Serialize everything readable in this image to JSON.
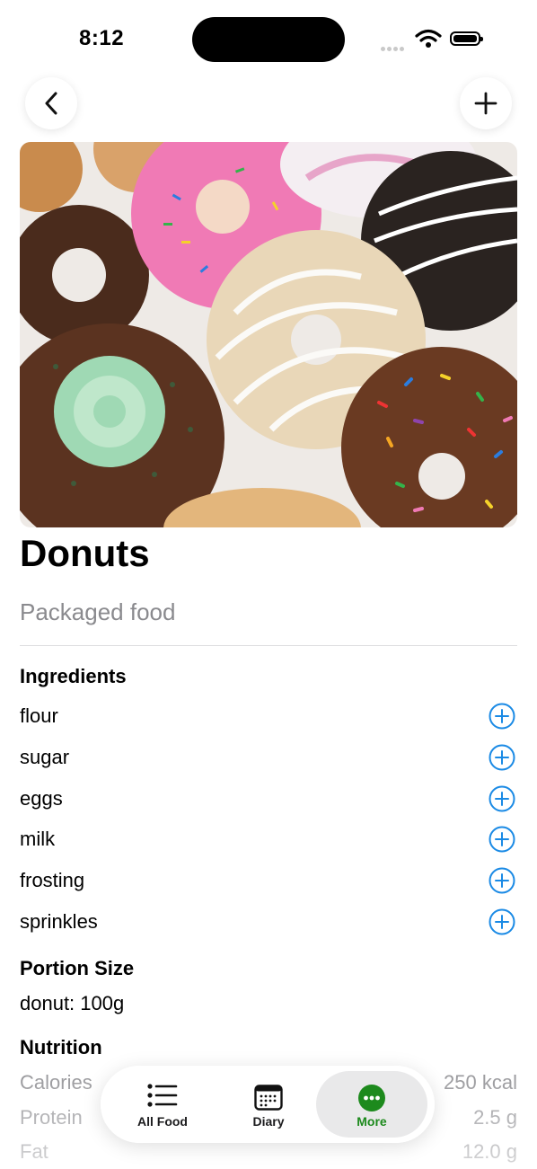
{
  "status_bar": {
    "time": "8:12"
  },
  "food": {
    "title": "Donuts",
    "subtitle": "Packaged food"
  },
  "ingredients": {
    "heading": "Ingredients",
    "items": [
      "flour",
      "sugar",
      "eggs",
      "milk",
      "frosting",
      "sprinkles"
    ]
  },
  "portion": {
    "heading": "Portion Size",
    "value": "donut: 100g"
  },
  "nutrition": {
    "heading": "Nutrition",
    "rows": [
      {
        "label": "Calories",
        "value": "250 kcal"
      },
      {
        "label": "Protein",
        "value": "2.5 g"
      },
      {
        "label": "Fat",
        "value": "12.0 g"
      }
    ]
  },
  "tabbar": {
    "tabs": [
      "All Food",
      "Diary",
      "More"
    ],
    "active": "More"
  },
  "colors": {
    "accent_blue": "#1a8ae5",
    "accent_green": "#1d8a1d"
  },
  "icons": {
    "back": "chevron-left-icon",
    "add": "plus-icon",
    "ingredient_add": "plus-circle-icon",
    "all_food": "list-icon",
    "diary": "calendar-icon",
    "more": "ellipsis-circle-icon"
  }
}
